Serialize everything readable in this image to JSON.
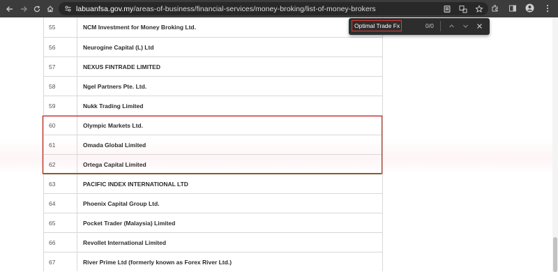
{
  "browser": {
    "url_host": "labuanfsa.gov.my",
    "url_path": "/areas-of-business/financial-services/money-broking/list-of-money-brokers"
  },
  "find_bar": {
    "query": "Optimal Trade Fx",
    "count": "0/0"
  },
  "table": {
    "rows": [
      {
        "num": "55",
        "name": "NCM Investment for Money Broking Ltd."
      },
      {
        "num": "56",
        "name": "Neurogine Capital (L) Ltd"
      },
      {
        "num": "57",
        "name": "NEXUS FINTRADE LIMITED"
      },
      {
        "num": "58",
        "name": "Ngel Partners Pte. Ltd."
      },
      {
        "num": "59",
        "name": "Nukk Trading Limited"
      },
      {
        "num": "60",
        "name": "Olympic Markets Ltd."
      },
      {
        "num": "61",
        "name": "Omada Global Limited"
      },
      {
        "num": "62",
        "name": "Ortega Capital Limited"
      },
      {
        "num": "63",
        "name": "PACIFIC INDEX INTERNATIONAL LTD"
      },
      {
        "num": "64",
        "name": "Phoenix Capital Group Ltd."
      },
      {
        "num": "65",
        "name": "Pocket Trader (Malaysia) Limited"
      },
      {
        "num": "66",
        "name": "Revollet International Limited"
      },
      {
        "num": "67",
        "name": "River Prime Ltd (formerly known as Forex River Ltd.)"
      }
    ]
  },
  "colors": {
    "highlight_border": "#c62828",
    "chrome_bg": "#3c3c3c"
  }
}
